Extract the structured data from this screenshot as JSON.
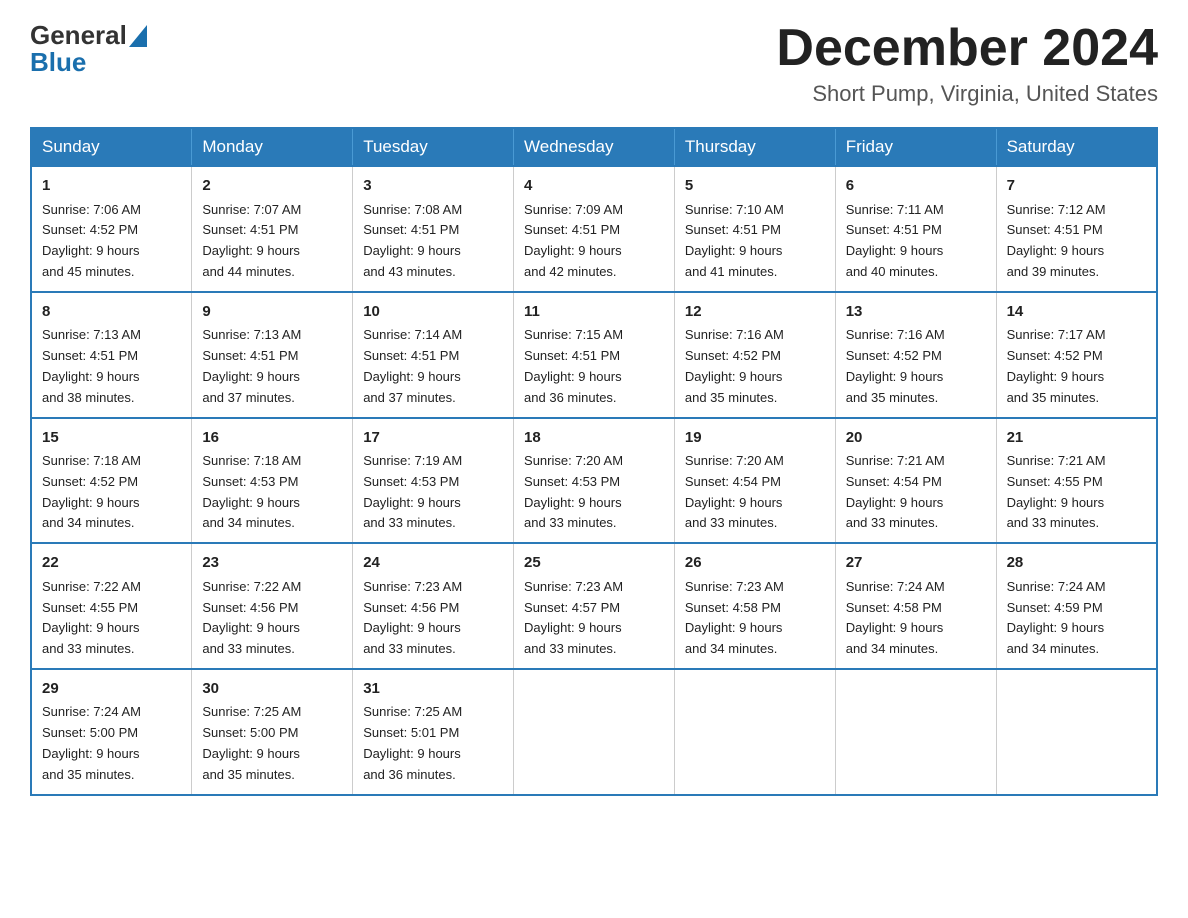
{
  "header": {
    "logo_general": "General",
    "logo_blue": "Blue",
    "month_title": "December 2024",
    "location": "Short Pump, Virginia, United States"
  },
  "days_of_week": [
    "Sunday",
    "Monday",
    "Tuesday",
    "Wednesday",
    "Thursday",
    "Friday",
    "Saturday"
  ],
  "weeks": [
    [
      {
        "day": "1",
        "sunrise": "7:06 AM",
        "sunset": "4:52 PM",
        "daylight": "9 hours and 45 minutes."
      },
      {
        "day": "2",
        "sunrise": "7:07 AM",
        "sunset": "4:51 PM",
        "daylight": "9 hours and 44 minutes."
      },
      {
        "day": "3",
        "sunrise": "7:08 AM",
        "sunset": "4:51 PM",
        "daylight": "9 hours and 43 minutes."
      },
      {
        "day": "4",
        "sunrise": "7:09 AM",
        "sunset": "4:51 PM",
        "daylight": "9 hours and 42 minutes."
      },
      {
        "day": "5",
        "sunrise": "7:10 AM",
        "sunset": "4:51 PM",
        "daylight": "9 hours and 41 minutes."
      },
      {
        "day": "6",
        "sunrise": "7:11 AM",
        "sunset": "4:51 PM",
        "daylight": "9 hours and 40 minutes."
      },
      {
        "day": "7",
        "sunrise": "7:12 AM",
        "sunset": "4:51 PM",
        "daylight": "9 hours and 39 minutes."
      }
    ],
    [
      {
        "day": "8",
        "sunrise": "7:13 AM",
        "sunset": "4:51 PM",
        "daylight": "9 hours and 38 minutes."
      },
      {
        "day": "9",
        "sunrise": "7:13 AM",
        "sunset": "4:51 PM",
        "daylight": "9 hours and 37 minutes."
      },
      {
        "day": "10",
        "sunrise": "7:14 AM",
        "sunset": "4:51 PM",
        "daylight": "9 hours and 37 minutes."
      },
      {
        "day": "11",
        "sunrise": "7:15 AM",
        "sunset": "4:51 PM",
        "daylight": "9 hours and 36 minutes."
      },
      {
        "day": "12",
        "sunrise": "7:16 AM",
        "sunset": "4:52 PM",
        "daylight": "9 hours and 35 minutes."
      },
      {
        "day": "13",
        "sunrise": "7:16 AM",
        "sunset": "4:52 PM",
        "daylight": "9 hours and 35 minutes."
      },
      {
        "day": "14",
        "sunrise": "7:17 AM",
        "sunset": "4:52 PM",
        "daylight": "9 hours and 35 minutes."
      }
    ],
    [
      {
        "day": "15",
        "sunrise": "7:18 AM",
        "sunset": "4:52 PM",
        "daylight": "9 hours and 34 minutes."
      },
      {
        "day": "16",
        "sunrise": "7:18 AM",
        "sunset": "4:53 PM",
        "daylight": "9 hours and 34 minutes."
      },
      {
        "day": "17",
        "sunrise": "7:19 AM",
        "sunset": "4:53 PM",
        "daylight": "9 hours and 33 minutes."
      },
      {
        "day": "18",
        "sunrise": "7:20 AM",
        "sunset": "4:53 PM",
        "daylight": "9 hours and 33 minutes."
      },
      {
        "day": "19",
        "sunrise": "7:20 AM",
        "sunset": "4:54 PM",
        "daylight": "9 hours and 33 minutes."
      },
      {
        "day": "20",
        "sunrise": "7:21 AM",
        "sunset": "4:54 PM",
        "daylight": "9 hours and 33 minutes."
      },
      {
        "day": "21",
        "sunrise": "7:21 AM",
        "sunset": "4:55 PM",
        "daylight": "9 hours and 33 minutes."
      }
    ],
    [
      {
        "day": "22",
        "sunrise": "7:22 AM",
        "sunset": "4:55 PM",
        "daylight": "9 hours and 33 minutes."
      },
      {
        "day": "23",
        "sunrise": "7:22 AM",
        "sunset": "4:56 PM",
        "daylight": "9 hours and 33 minutes."
      },
      {
        "day": "24",
        "sunrise": "7:23 AM",
        "sunset": "4:56 PM",
        "daylight": "9 hours and 33 minutes."
      },
      {
        "day": "25",
        "sunrise": "7:23 AM",
        "sunset": "4:57 PM",
        "daylight": "9 hours and 33 minutes."
      },
      {
        "day": "26",
        "sunrise": "7:23 AM",
        "sunset": "4:58 PM",
        "daylight": "9 hours and 34 minutes."
      },
      {
        "day": "27",
        "sunrise": "7:24 AM",
        "sunset": "4:58 PM",
        "daylight": "9 hours and 34 minutes."
      },
      {
        "day": "28",
        "sunrise": "7:24 AM",
        "sunset": "4:59 PM",
        "daylight": "9 hours and 34 minutes."
      }
    ],
    [
      {
        "day": "29",
        "sunrise": "7:24 AM",
        "sunset": "5:00 PM",
        "daylight": "9 hours and 35 minutes."
      },
      {
        "day": "30",
        "sunrise": "7:25 AM",
        "sunset": "5:00 PM",
        "daylight": "9 hours and 35 minutes."
      },
      {
        "day": "31",
        "sunrise": "7:25 AM",
        "sunset": "5:01 PM",
        "daylight": "9 hours and 36 minutes."
      },
      null,
      null,
      null,
      null
    ]
  ],
  "labels": {
    "sunrise": "Sunrise:",
    "sunset": "Sunset:",
    "daylight": "Daylight:"
  }
}
